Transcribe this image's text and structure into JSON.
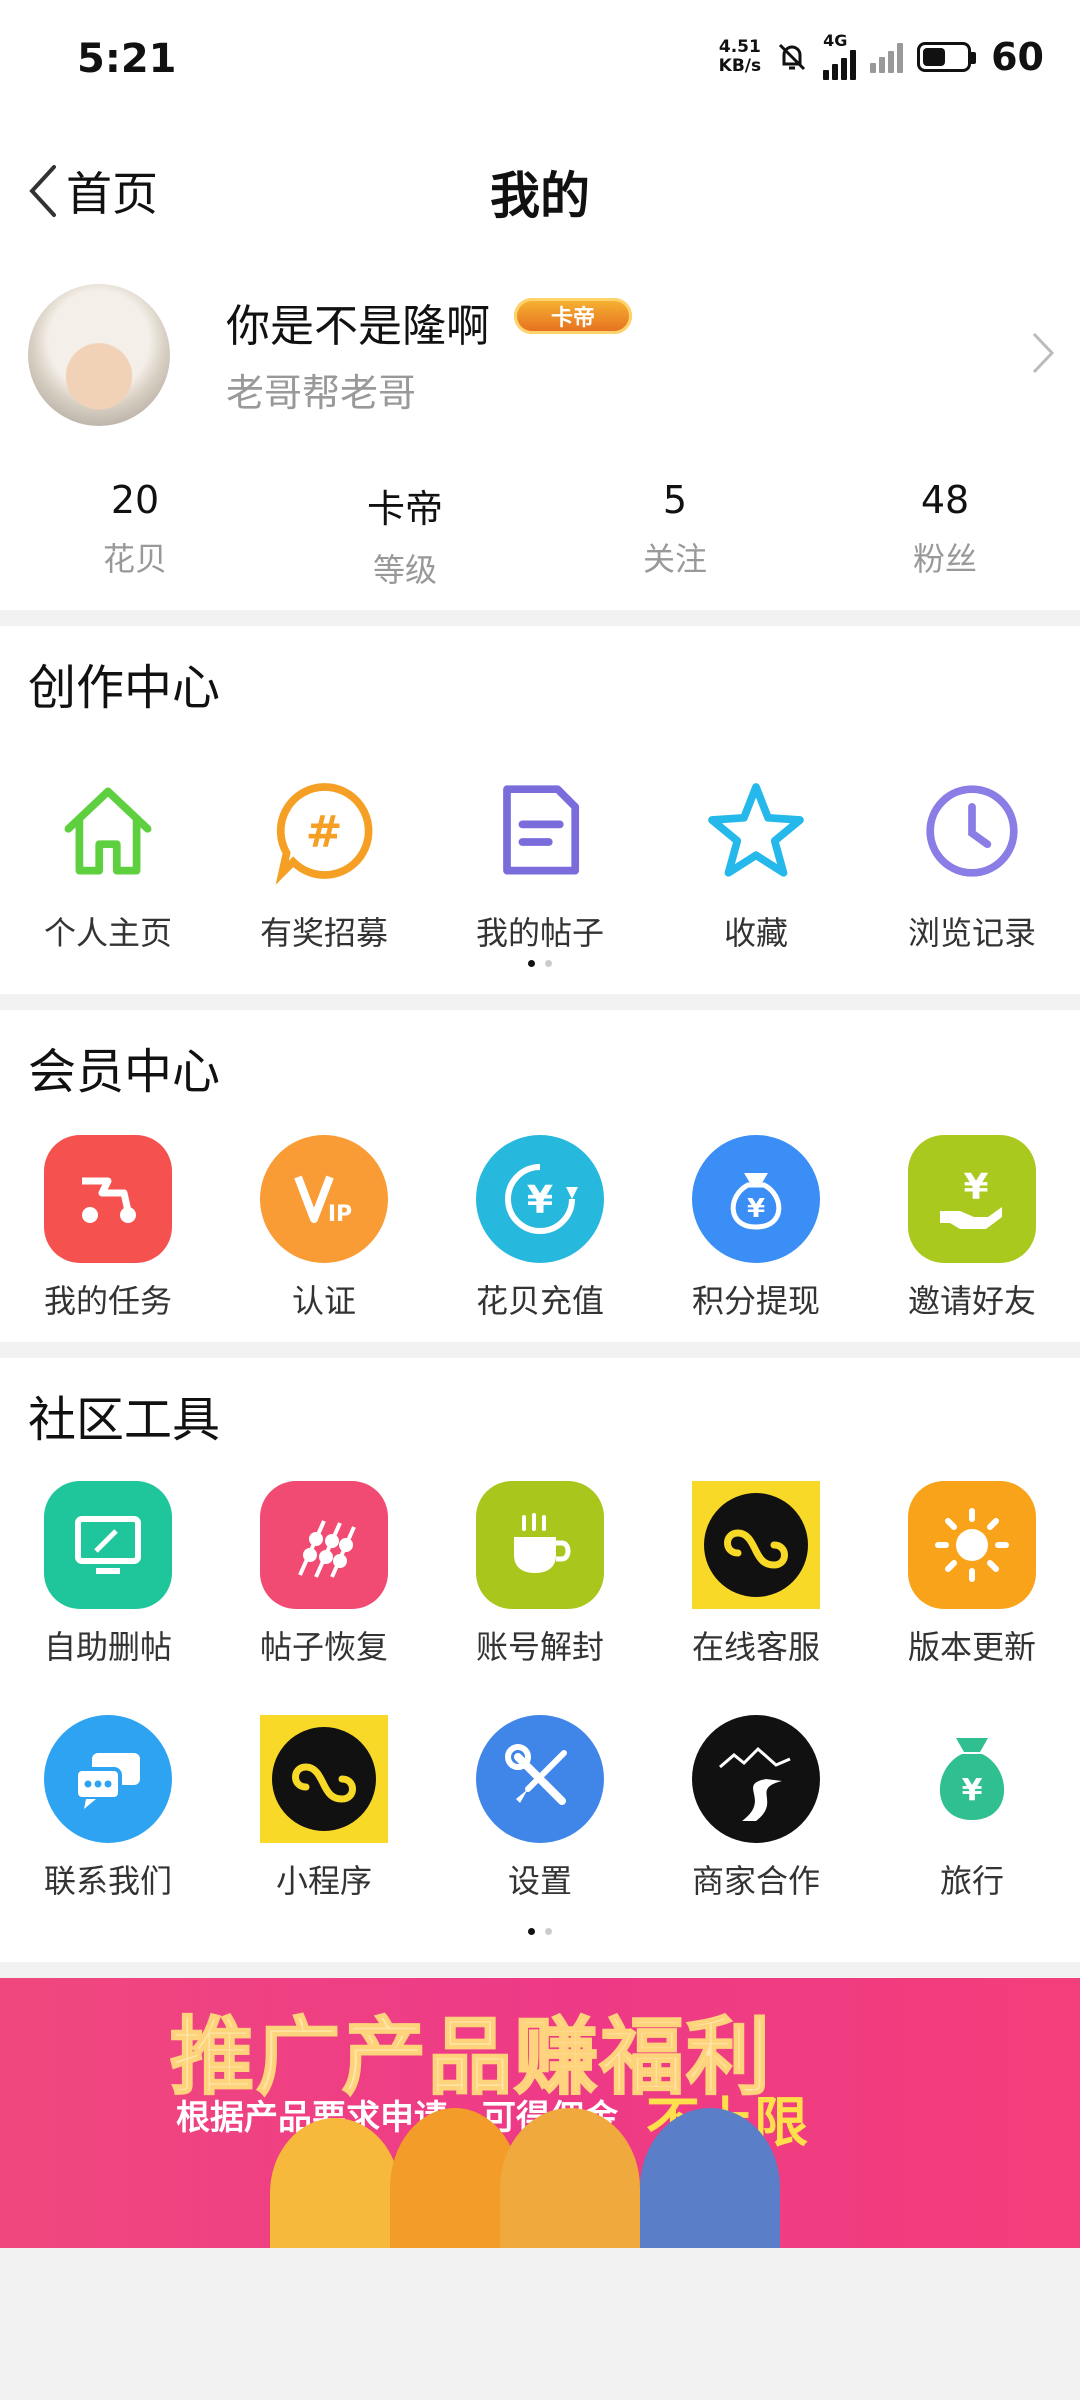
{
  "status": {
    "time": "5:21",
    "net_speed_value": "4.51",
    "net_speed_unit": "KB/s",
    "network_type": "4G",
    "battery": "60"
  },
  "header": {
    "back_label": "首页",
    "title": "我的"
  },
  "profile": {
    "name": "你是不是隆啊",
    "badge": "卡帝",
    "subtitle": "老哥帮老哥",
    "stats": [
      {
        "value": "20",
        "label": "花贝"
      },
      {
        "value": "卡帝",
        "label": "等级"
      },
      {
        "value": "5",
        "label": "关注"
      },
      {
        "value": "48",
        "label": "粉丝"
      }
    ]
  },
  "creation": {
    "title": "创作中心",
    "items": [
      {
        "label": "个人主页",
        "icon": "home-icon"
      },
      {
        "label": "有奖招募",
        "icon": "hashtag-icon"
      },
      {
        "label": "我的帖子",
        "icon": "document-icon"
      },
      {
        "label": "收藏",
        "icon": "star-icon"
      },
      {
        "label": "浏览记录",
        "icon": "clock-icon"
      }
    ]
  },
  "member": {
    "title": "会员中心",
    "items": [
      {
        "label": "我的任务",
        "icon": "scooter-icon",
        "color": "#f5524f"
      },
      {
        "label": "认证",
        "icon": "vip-icon",
        "color": "#f99c35"
      },
      {
        "label": "花贝充值",
        "icon": "yuan-refresh-icon",
        "color": "#27b8dd"
      },
      {
        "label": "积分提现",
        "icon": "money-bag-icon",
        "color": "#3b8ef5"
      },
      {
        "label": "邀请好友",
        "icon": "hand-yuan-icon",
        "color": "#a9c91f"
      }
    ]
  },
  "tools": {
    "title": "社区工具",
    "row1": [
      {
        "label": "自助删帖",
        "icon": "monitor-edit-icon",
        "color": "#1fc59b"
      },
      {
        "label": "帖子恢复",
        "icon": "skewer-icon",
        "color": "#f24b73"
      },
      {
        "label": "账号解封",
        "icon": "coffee-cup-icon",
        "color": "#a8c61c"
      },
      {
        "label": "在线客服",
        "icon": "mini-program-icon",
        "color": "#f8d928"
      },
      {
        "label": "版本更新",
        "icon": "sun-icon",
        "color": "#f9a31a"
      }
    ],
    "row2": [
      {
        "label": "联系我们",
        "icon": "chat-bubbles-icon",
        "color": "#2ea3f2"
      },
      {
        "label": "小程序",
        "icon": "mini-program-icon",
        "color": "#f8d928"
      },
      {
        "label": "设置",
        "icon": "wrench-screwdriver-icon",
        "color": "#3f86e8"
      },
      {
        "label": "商家合作",
        "icon": "mountain-road-icon",
        "color": "#111111"
      },
      {
        "label": "旅行",
        "icon": "money-bag-icon",
        "color": "#2fbf90"
      }
    ]
  },
  "banner": {
    "title": "推广产品赚福利",
    "subtitle": "根据产品要求申请，可得佣金",
    "accent": "不上限"
  }
}
